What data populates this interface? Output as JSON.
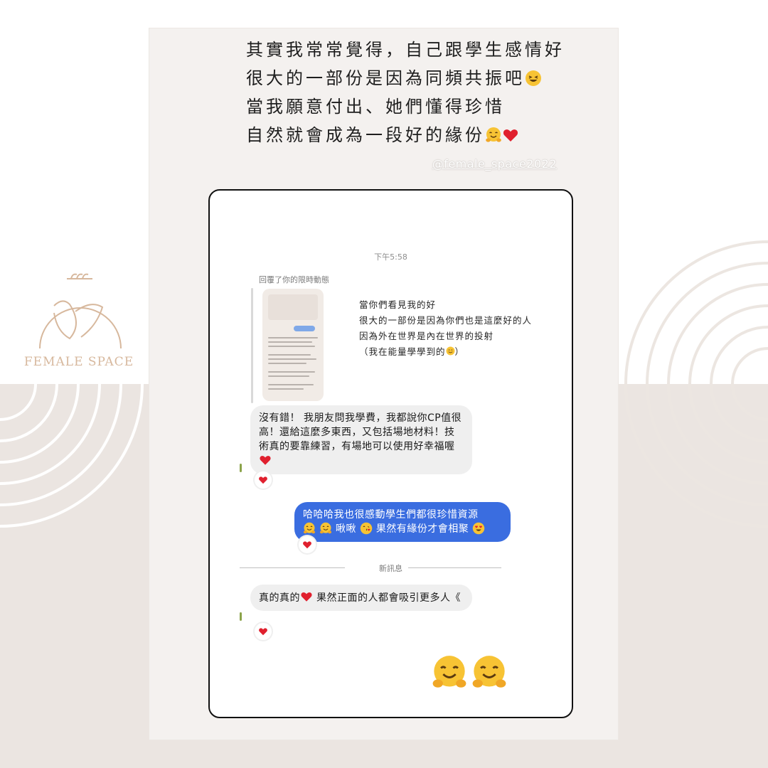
{
  "brand": {
    "logo_text": "FEMALE SPACE",
    "accent": "#d7b89d"
  },
  "story": {
    "caption_lines": [
      "其實我常常覺得，自己跟學生感情好",
      "很大的一部份是因為同頻共振吧",
      "當我願意付出、她們懂得珍惜",
      "自然就會成為一段好的緣份"
    ],
    "watermark": "@female_space2022"
  },
  "chat": {
    "timestamp": "下午5:58",
    "reply_label": "回覆了你的限時動態",
    "quoted_story_lines": [
      "當你們看見我的好",
      "很大的一部份是因為你們也是這麼好的人",
      "因為外在世界是內在世界的投射",
      "（我在能量學學到的"
    ],
    "quote_end": "）",
    "messages": [
      {
        "from": "them",
        "text": "沒有錯！ 我朋友問我學費，我都說你CP值很高！還給這麼多東西，又包括場地材料！技術真的要靠練習，有場地可以使用好幸福喔"
      },
      {
        "from": "me",
        "text_1": "哈哈哈我也很感動學生們都很珍惜資源",
        "text_2": "啾啾",
        "text_3": "果然有緣份才會相聚"
      },
      {
        "from": "them",
        "text_1": "真的真的",
        "text_2": "果然正面的人都會吸引更多人《"
      }
    ],
    "divider": "新訊息"
  },
  "colors": {
    "panel": "#f4f1ef",
    "background_band": "#ebe5e1",
    "bubble_gray": "#efefef",
    "bubble_blue": "#3a6de0",
    "heart": "#e0202e",
    "emoji": "#f7c334"
  }
}
